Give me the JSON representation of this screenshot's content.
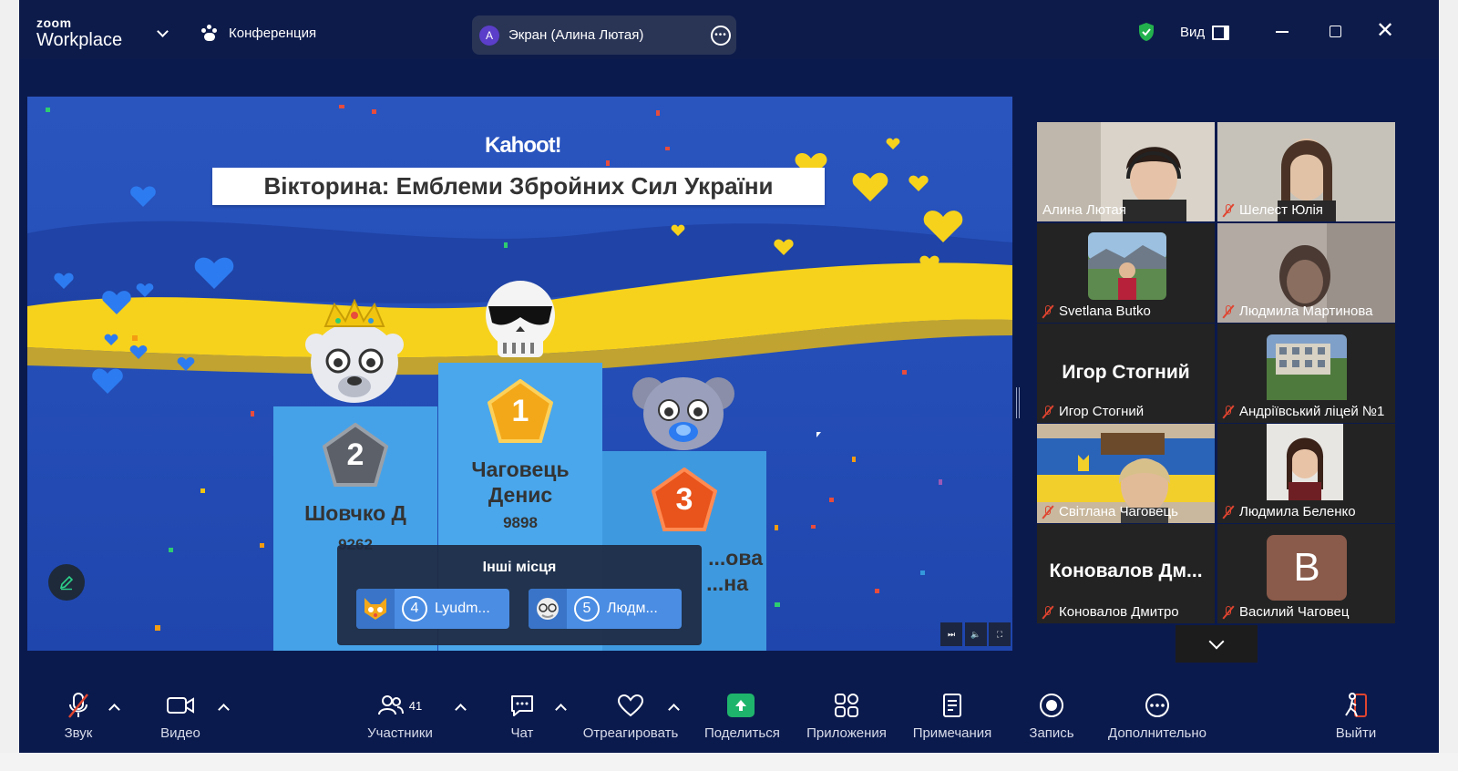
{
  "titlebar": {
    "brand_top": "zoom",
    "brand_bottom": "Workplace",
    "conference_label": "Конференция",
    "screen_avatar_letter": "A",
    "screen_share_label": "Экран (Алина Лютая)",
    "view_label": "Вид"
  },
  "share": {
    "logo": "Kahoot!",
    "quiz_title": "Вікторина: Емблеми Збройних Сил України",
    "podium": [
      {
        "place": "1",
        "name_line1": "Чаговець",
        "name_line2": "Денис",
        "score": "9898"
      },
      {
        "place": "2",
        "name_line1": "Шовчко Д",
        "name_line2": "",
        "score": "9262"
      },
      {
        "place": "3",
        "name_line1": "...ова",
        "name_line2": "...на",
        "score": ""
      }
    ],
    "other_places": {
      "title": "Інші місця",
      "items": [
        {
          "num": "4",
          "name": "Lyudm..."
        },
        {
          "num": "5",
          "name": "Людм..."
        }
      ]
    }
  },
  "gallery": [
    {
      "name": "Алина Лютая",
      "muted": false,
      "active": true,
      "kind": "video"
    },
    {
      "name": "Шелест Юлія",
      "muted": true,
      "active": false,
      "kind": "video"
    },
    {
      "name": "Svetlana Butko",
      "muted": true,
      "active": false,
      "kind": "photo"
    },
    {
      "name": "Людмила Мартинова",
      "muted": true,
      "active": false,
      "kind": "video"
    },
    {
      "name": "Игор Стогний",
      "muted": true,
      "active": false,
      "kind": "text",
      "big": "Игор Стогний"
    },
    {
      "name": "Андріївський ліцей №1",
      "muted": true,
      "active": false,
      "kind": "photo"
    },
    {
      "name": "Світлана Чаговець",
      "muted": true,
      "active": false,
      "kind": "video"
    },
    {
      "name": "Людмила Беленко",
      "muted": true,
      "active": false,
      "kind": "video"
    },
    {
      "name": "Коновалов Дмитро",
      "muted": true,
      "active": false,
      "kind": "text",
      "big": "Коновалов  Дм..."
    },
    {
      "name": "Василий Чаговец",
      "muted": true,
      "active": false,
      "kind": "letter",
      "letter": "В"
    }
  ],
  "toolbar": {
    "audio": "Звук",
    "video": "Видео",
    "participants": "Участники",
    "participants_count": "41",
    "chat": "Чат",
    "react": "Отреагировать",
    "share": "Поделиться",
    "apps": "Приложения",
    "notes": "Примечания",
    "record": "Запись",
    "more": "Дополнительно",
    "leave": "Выйти"
  },
  "colors": {
    "titlebar_bg": "#0d1b4a",
    "main_bg": "#0b1a4d",
    "active_speaker": "#2dd28a",
    "share_green": "#1fb46b",
    "muted_red": "#e0442f",
    "slide_blue": "#234cb3",
    "slide_yellow": "#f7d21c"
  }
}
